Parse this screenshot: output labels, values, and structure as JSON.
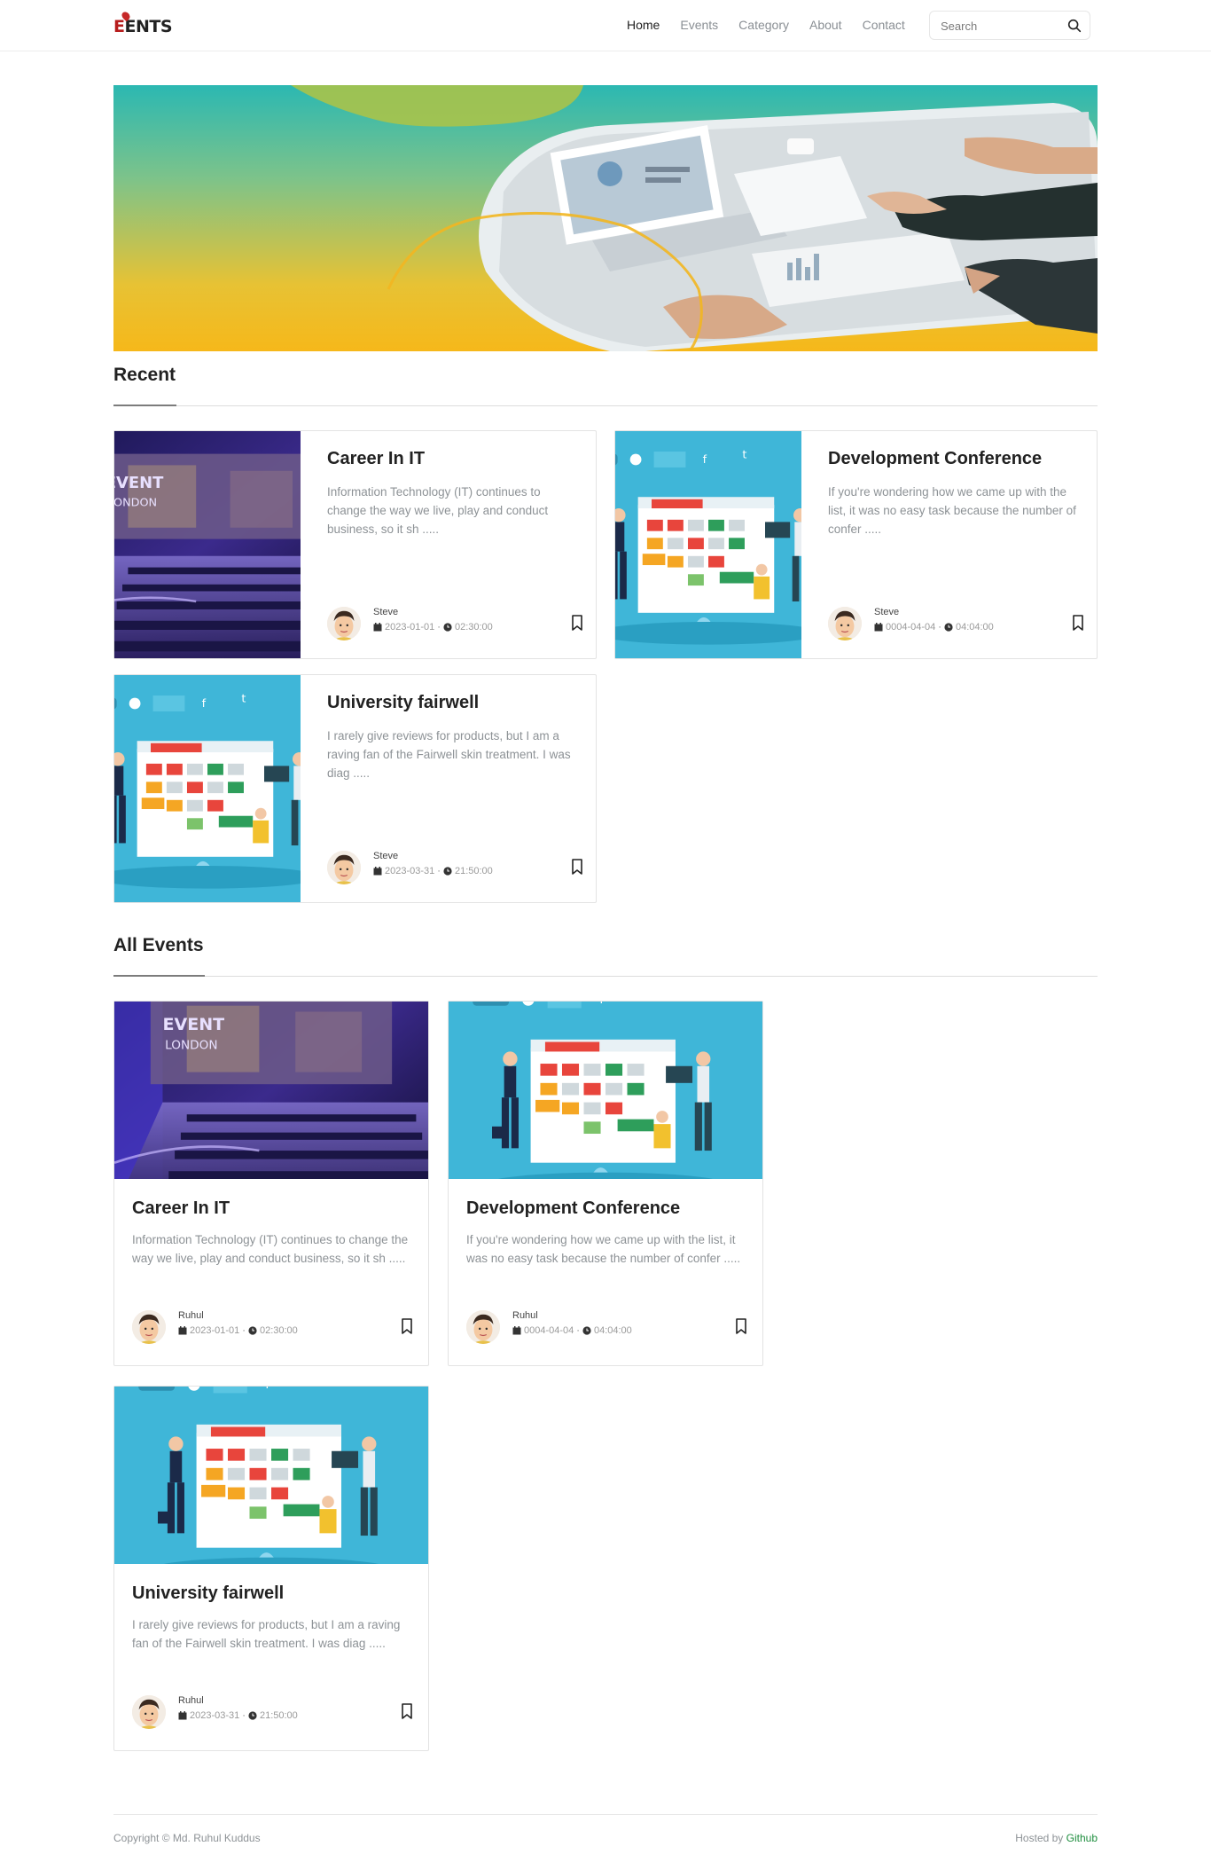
{
  "header": {
    "brand": {
      "prefix": "E",
      "rest": "ENTS"
    },
    "nav": [
      {
        "label": "Home",
        "active": true
      },
      {
        "label": "Events",
        "active": false
      },
      {
        "label": "Category",
        "active": false
      },
      {
        "label": "About",
        "active": false
      },
      {
        "label": "Contact",
        "active": false
      }
    ],
    "search": {
      "placeholder": "Search",
      "icon": "search-icon"
    }
  },
  "hero": {
    "image": "business-meeting-laptop-charts"
  },
  "recent": {
    "title": "Recent",
    "items": [
      {
        "title": "Career In IT",
        "desc": "Information Technology (IT) continues to change the way we live, play and conduct business, so it sh .....",
        "author": "Steve",
        "date": "2023-01-01",
        "time": "02:30:00",
        "image": "event-conference-hall"
      },
      {
        "title": "Development Conference",
        "desc": "If you're wondering how we came up with the list, it was no easy task because the number of confer .....",
        "author": "Steve",
        "date": "0004-04-04",
        "time": "04:04:00",
        "image": "calendar-illustration"
      },
      {
        "title": "University fairwell",
        "desc": "I rarely give reviews for products, but I am a raving fan of the Fairwell skin treatment. I was diag .....",
        "author": "Steve",
        "date": "2023-03-31",
        "time": "21:50:00",
        "image": "calendar-illustration"
      }
    ]
  },
  "all_events": {
    "title": "All Events",
    "items": [
      {
        "title": "Career In IT",
        "desc": "Information Technology (IT) continues to change the way we live, play and conduct business, so it sh .....",
        "author": "Ruhul",
        "date": "2023-01-01",
        "time": "02:30:00",
        "image": "event-conference-hall"
      },
      {
        "title": "Development Conference",
        "desc": "If you're wondering how we came up with the list, it was no easy task because the number of confer .....",
        "author": "Ruhul",
        "date": "0004-04-04",
        "time": "04:04:00",
        "image": "calendar-illustration"
      },
      {
        "title": "University fairwell",
        "desc": "I rarely give reviews for products, but I am a raving fan of the Fairwell skin treatment. I was diag .....",
        "author": "Ruhul",
        "date": "2023-03-31",
        "time": "21:50:00",
        "image": "calendar-illustration"
      }
    ]
  },
  "footer": {
    "copyright": "Copyright © Md. Ruhul Kuddus",
    "hosted_prefix": "Hosted by",
    "hosted_link": "Github"
  },
  "colors": {
    "accent_teal": "#2bb8b2",
    "accent_yellow": "#f6b81a",
    "illustration_bg": "#3fb6d8",
    "link_green": "#1e8e3e"
  }
}
